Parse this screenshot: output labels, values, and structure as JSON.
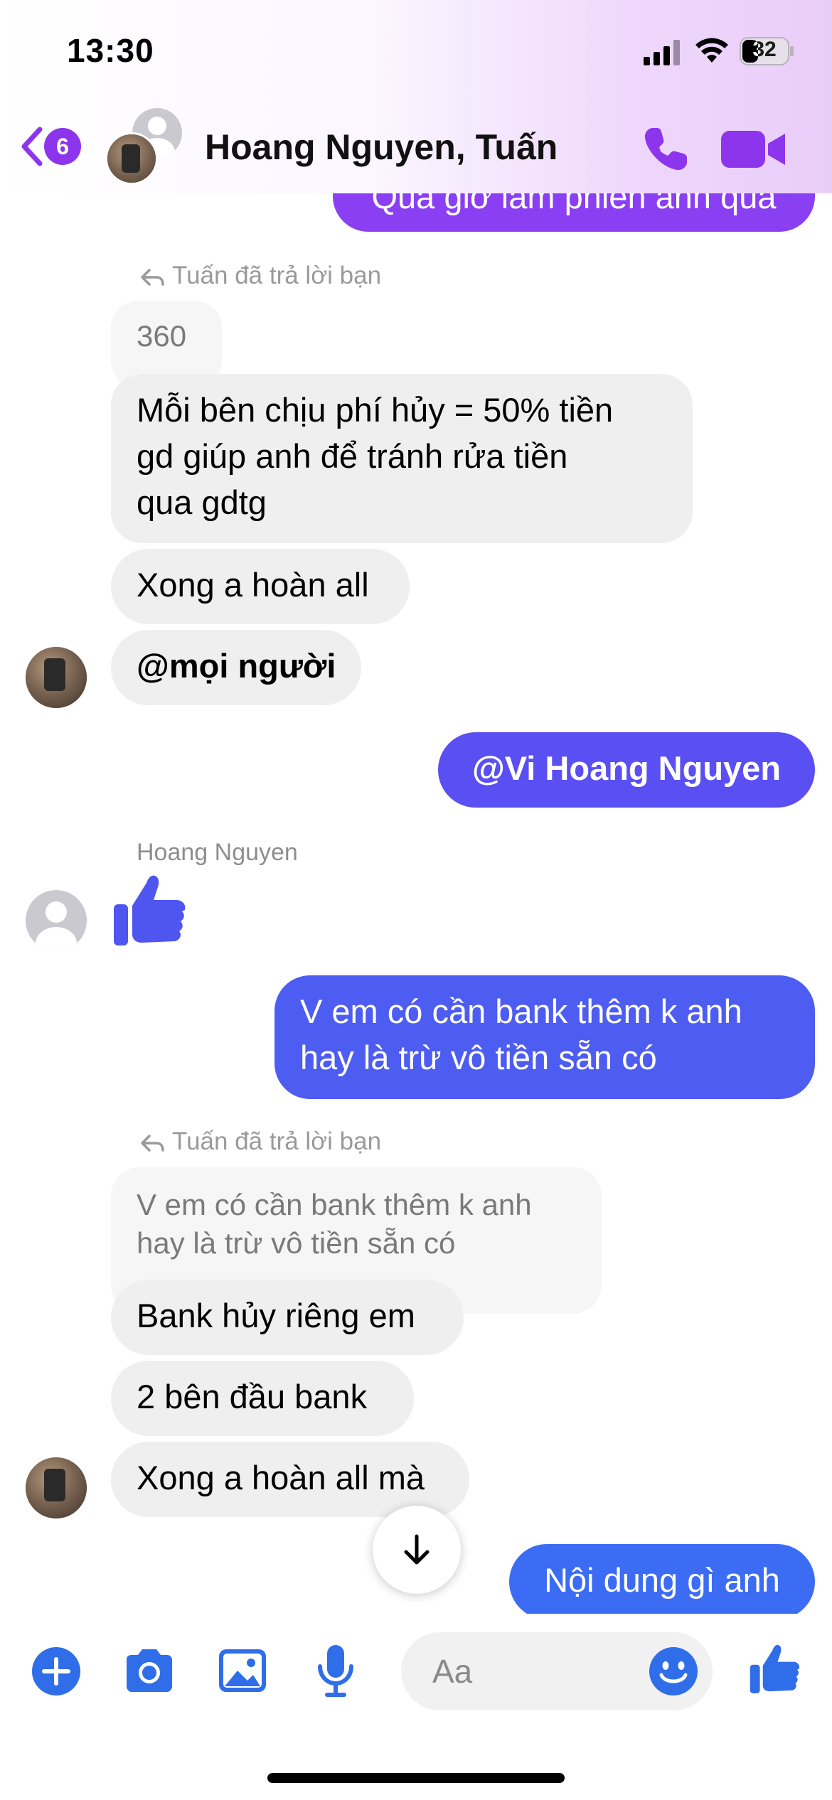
{
  "status_bar": {
    "time": "13:30",
    "battery": "32"
  },
  "header": {
    "unread_count": "6",
    "title": "Hoang Nguyen, Tuấn",
    "colors": {
      "accent": "#8d35ec"
    }
  },
  "messages": {
    "partial_top": "Quá giờ làm phiền anh quá",
    "reply_label_1": "Tuấn đã trả lời bạn",
    "quote_1": "360",
    "m1_line1": "Mỗi bên chịu phí hủy = 50% tiền",
    "m1_line2": "gd giúp anh để tránh rửa tiền",
    "m1_line3": "qua gdtg",
    "m2": "Xong a hoàn all",
    "m3": "@mọi người",
    "out_mention": "@Vi Hoang Nguyen",
    "sender_hoang": "Hoang Nguyen",
    "out_q_line1": "V em có cần bank thêm k anh",
    "out_q_line2": "hay là trừ vô tiền sẵn có",
    "reply_label_2": "Tuấn đã trả lời bạn",
    "quote_2_line1": "V em có cần bank thêm k anh",
    "quote_2_line2": "hay là trừ vô tiền sẵn có",
    "m4": "Bank hủy riêng em",
    "m5": "2 bên đầu bank",
    "m6": "Xong a hoàn all mà",
    "out_last": "Nội dung gì anh"
  },
  "composer": {
    "placeholder": "Aa"
  },
  "icons": [
    "back-chevron-icon",
    "phone-icon",
    "video-camera-icon",
    "reply-arrow-icon",
    "like-thumb-icon",
    "arrow-down-icon",
    "plus-icon",
    "camera-icon",
    "image-icon",
    "microphone-icon",
    "emoji-icon"
  ],
  "colors": {
    "outgoing_top": "#8a3ff2",
    "outgoing_mid": "#5b4ff2",
    "outgoing_bottom": "#3c6cf3",
    "incoming": "#efefef",
    "toolbar_blue": "#2f6ee8"
  }
}
